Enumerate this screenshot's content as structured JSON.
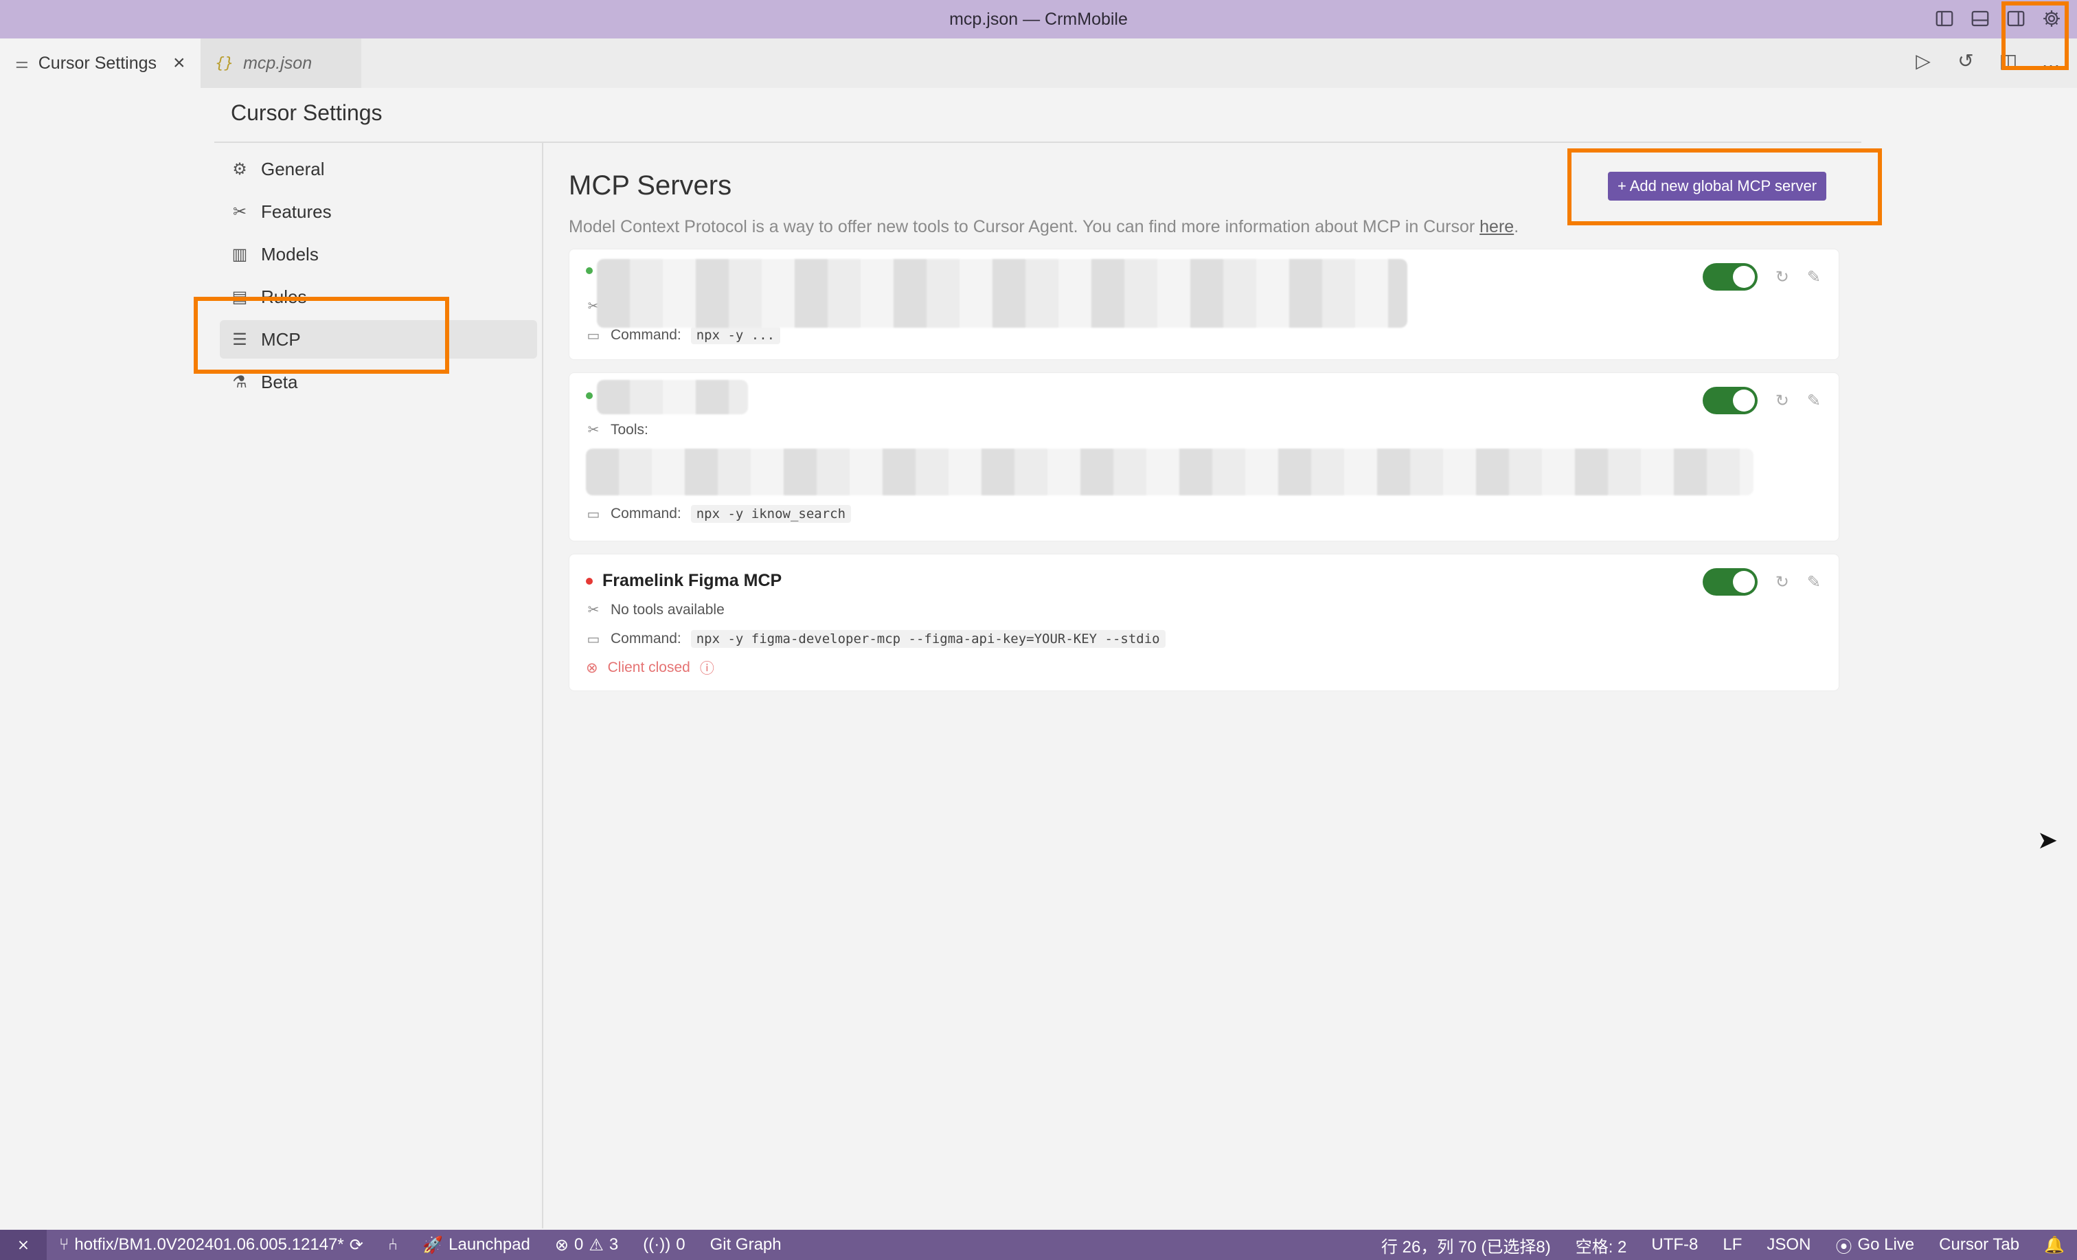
{
  "window": {
    "title": "mcp.json — CrmMobile"
  },
  "tabs": [
    {
      "label": "Cursor Settings",
      "close": "×"
    },
    {
      "label": "mcp.json",
      "icon_text": "{}"
    }
  ],
  "settings": {
    "title": "Cursor Settings",
    "nav": [
      {
        "label": "General",
        "icon": "gear-icon"
      },
      {
        "label": "Features",
        "icon": "tools-icon"
      },
      {
        "label": "Models",
        "icon": "chart-icon"
      },
      {
        "label": "Rules",
        "icon": "book-icon"
      },
      {
        "label": "MCP",
        "icon": "server-icon",
        "selected": true
      },
      {
        "label": "Beta",
        "icon": "flask-icon"
      }
    ]
  },
  "mcp": {
    "title": "MCP Servers",
    "description": "Model Context Protocol is a way to offer new tools to Cursor Agent. You can find more information about MCP in Cursor ",
    "link_text": "here",
    "period": ".",
    "add_button": "+ Add new global MCP server",
    "servers": [
      {
        "status": "green",
        "command_label": "Command:",
        "command": "npx -y ...",
        "enabled": true
      },
      {
        "status": "green",
        "tools_label": "Tools:",
        "tools_visible": [
          "search-irescloud_knowledge"
        ],
        "command_label": "Command:",
        "command": "npx -y iknow_search",
        "enabled": true
      },
      {
        "status": "red",
        "name": "Framelink Figma MCP",
        "tools_text": "No tools available",
        "command_label": "Command:",
        "command": "npx -y figma-developer-mcp --figma-api-key=YOUR-KEY --stdio",
        "error": "Client closed",
        "enabled": true
      }
    ]
  },
  "statusbar": {
    "branch": "hotfix/BM1.0V202401.06.005.12147*",
    "launchpad": "Launchpad",
    "errors": "0",
    "warnings": "3",
    "ports": "0",
    "git_graph": "Git Graph",
    "cursor_pos": "行 26，列 70 (已选择8)",
    "indent": "空格: 2",
    "encoding": "UTF-8",
    "eol": "LF",
    "language": "JSON",
    "go_live": "Go Live",
    "cursor_tab": "Cursor Tab"
  },
  "colors": {
    "titlebar": "#c4b3d9",
    "statusbar": "#6f5a8f",
    "accent_button": "#6e55a8",
    "toggle_on": "#2e7d32",
    "highlight": "#f57c00"
  }
}
